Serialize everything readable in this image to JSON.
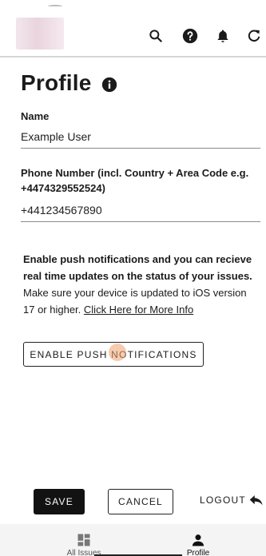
{
  "header": {
    "icons": [
      "search-icon",
      "help-icon",
      "bell-icon",
      "refresh-icon"
    ]
  },
  "page": {
    "title": "Profile"
  },
  "form": {
    "name_label": "Name",
    "name_value": "Example User",
    "phone_label": "Phone Number (incl. Country + Area Code e.g. +4474329552524)",
    "phone_value": "+441234567890"
  },
  "push": {
    "bold_text": "Enable push notifications and you can recieve real time updates on the status of your issues.",
    "regular_text": "Make sure your device is updated to iOS version 17 or higher.",
    "link_text": "Click Here for More Info",
    "button_label": "ENABLE PUSH NOTIFICATIONS"
  },
  "actions": {
    "save_label": "SAVE",
    "cancel_label": "CANCEL",
    "logout_label": "LOGOUT"
  },
  "bottom_nav": {
    "items": [
      {
        "label": "All Issues",
        "icon": "dashboard-icon"
      },
      {
        "label": "Profile",
        "icon": "person-icon",
        "active": true
      }
    ]
  }
}
